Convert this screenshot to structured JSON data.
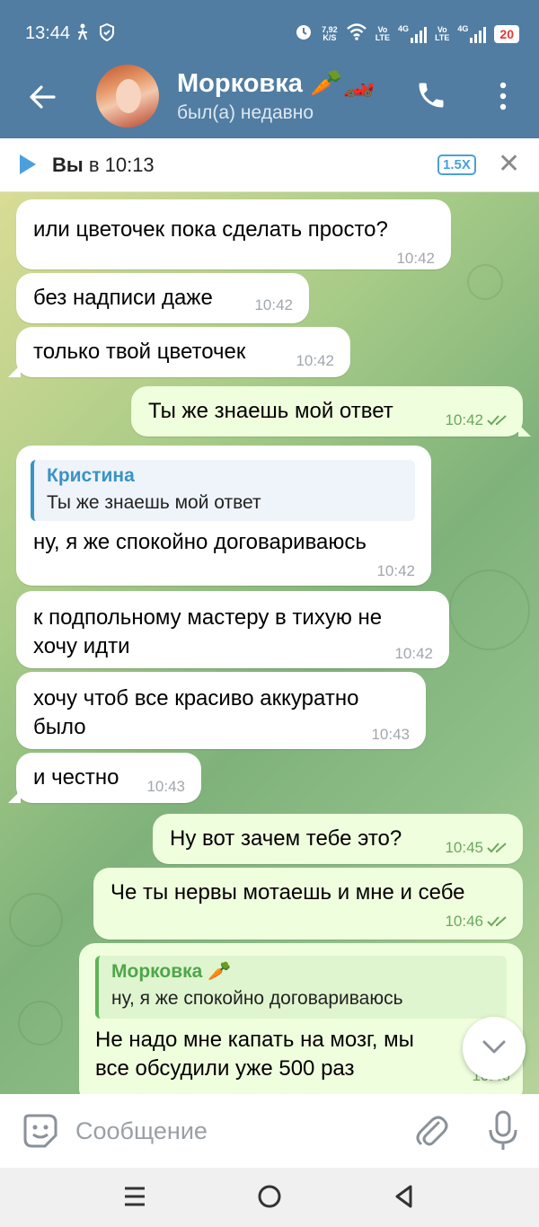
{
  "status_bar": {
    "time": "13:44",
    "speed_value": "7,92",
    "speed_unit": "K/S",
    "net1_top": "Vo",
    "net1_bottom": "LTE",
    "net2": "4G",
    "net3_top": "Vo",
    "net3_bottom": "LTE",
    "net4": "4G",
    "battery": "20",
    "battery_color": "#e53935"
  },
  "header": {
    "contact_name": "Морковка 🥕🏎️",
    "status": "был(а) недавно",
    "back_icon": "arrow-left-icon",
    "call_icon": "phone-icon",
    "more_icon": "more-vertical-icon",
    "bar_color": "#517da2"
  },
  "player": {
    "sender": "Вы",
    "time_text": "в 10:13",
    "speed": "1.5X",
    "close_icon": "close-icon"
  },
  "messages": [
    {
      "dir": "in",
      "text": "или цветочек пока сделать просто?",
      "time": "10:42"
    },
    {
      "dir": "in",
      "text": "без надписи даже",
      "time": "10:42"
    },
    {
      "dir": "in",
      "text": "только твой цветочек",
      "time": "10:42"
    },
    {
      "dir": "out",
      "text": "Ты же знаешь мой ответ",
      "time": "10:42"
    },
    {
      "dir": "in",
      "reply_name": "Кристина",
      "reply_text": "Ты же знаешь мой ответ",
      "text": "ну, я же спокойно договариваюсь",
      "time": "10:42"
    },
    {
      "dir": "in",
      "text_line1": "к подпольному мастеру в тихую не",
      "text_line2": "хочу идти",
      "time": "10:42"
    },
    {
      "dir": "in",
      "text_line1": "хочу чтоб все красиво аккуратно",
      "text_line2": "было",
      "time": "10:43"
    },
    {
      "dir": "in",
      "text": "и честно",
      "time": "10:43"
    },
    {
      "dir": "out",
      "text": "Ну вот зачем тебе это?",
      "time": "10:45"
    },
    {
      "dir": "out",
      "text": "Че ты нервы мотаешь и мне и себе",
      "time": "10:46"
    },
    {
      "dir": "out",
      "reply_name": "Морковка 🥕",
      "reply_text": "ну, я же спокойно договариваюсь",
      "text_line1": "Не надо мне капать на мозг, мы",
      "text_line2": "все обсудили уже 500 раз",
      "time": "10:46"
    }
  ],
  "input": {
    "placeholder": "Сообщение",
    "emoji_icon": "sticker-icon",
    "attach_icon": "paperclip-icon",
    "mic_icon": "microphone-icon"
  },
  "nav": {
    "recents_icon": "recents-icon",
    "home_icon": "home-icon",
    "back_icon": "back-triangle-icon"
  },
  "colors": {
    "incoming_bubble": "#ffffff",
    "outgoing_bubble": "#effedd",
    "accent": "#4aa0dc",
    "read_check": "#6aa85e"
  }
}
